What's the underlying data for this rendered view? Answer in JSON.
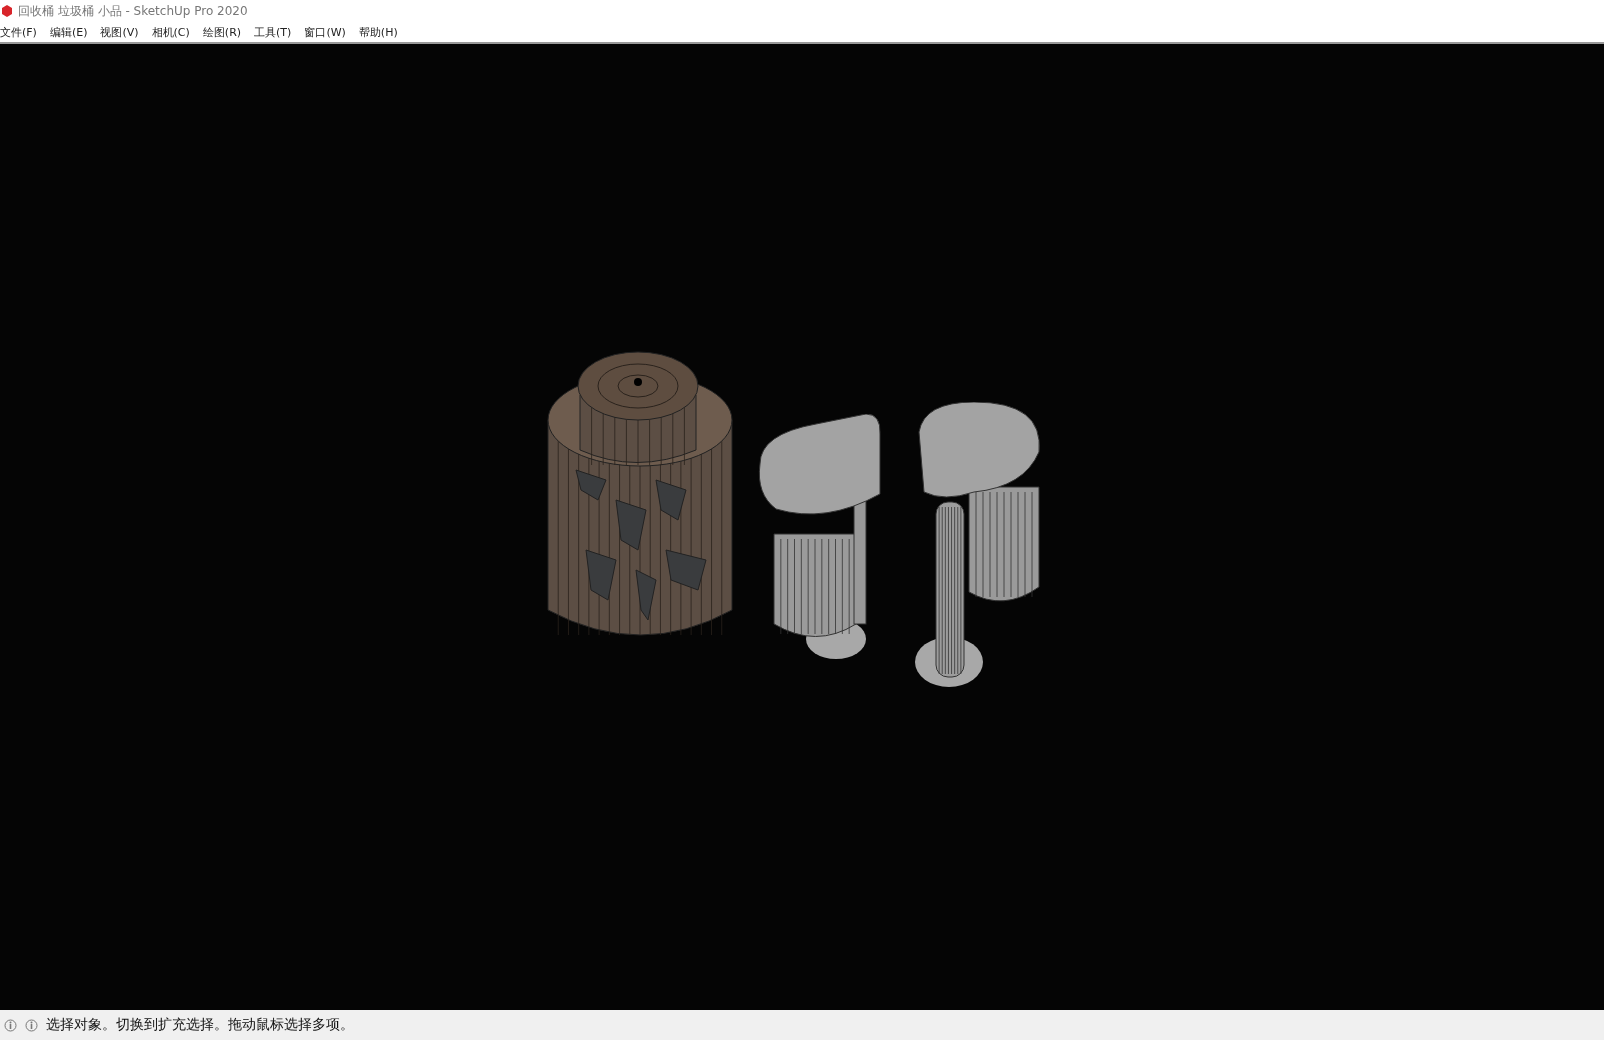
{
  "window": {
    "title": "回收桶 垃圾桶 小品 - SketchUp Pro 2020"
  },
  "menu": [
    "文件(F)",
    "编辑(E)",
    "视图(V)",
    "相机(C)",
    "绘图(R)",
    "工具(T)",
    "窗口(W)",
    "帮助(H)"
  ],
  "status_bar": {
    "message": "选择对象。切换到扩充选择。拖动鼠标选择多项。"
  }
}
